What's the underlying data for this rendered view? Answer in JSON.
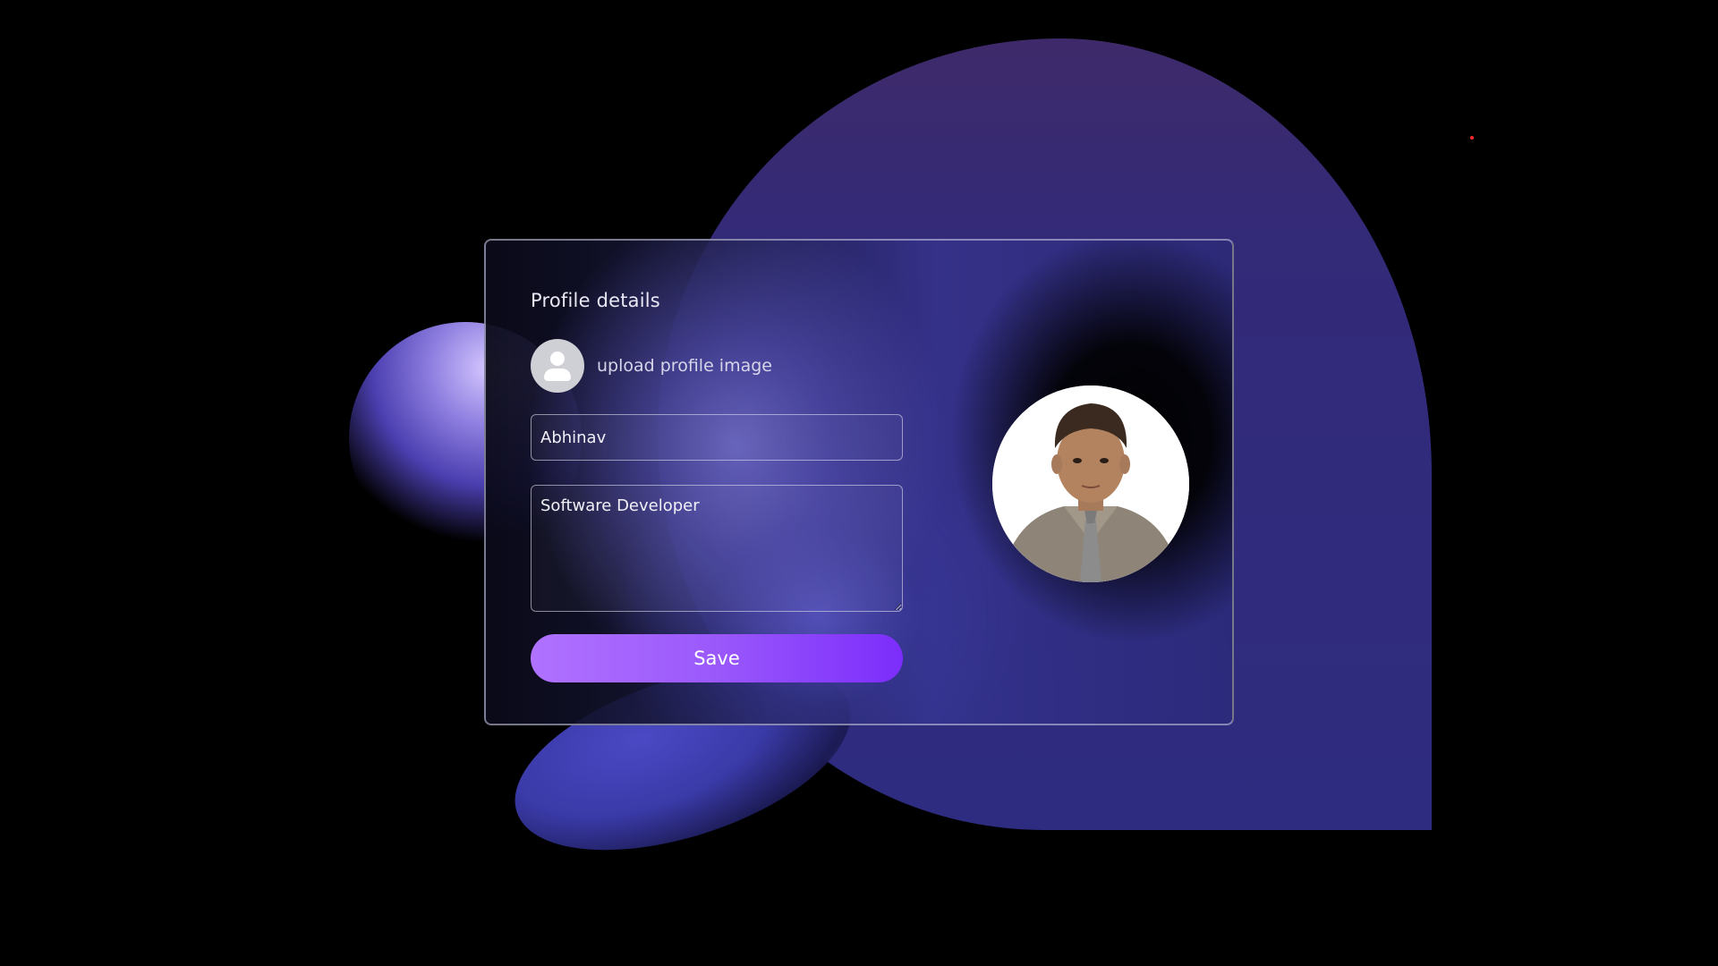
{
  "card": {
    "title": "Profile details",
    "upload_label": "upload profile image",
    "name_value": "Abhinav",
    "bio_value": "Software Developer",
    "save_label": "Save"
  },
  "icons": {
    "avatar_placeholder": "user-avatar-icon"
  },
  "colors": {
    "background": "#000000",
    "blob_primary": "#2e2c80",
    "save_gradient_start": "#b072ff",
    "save_gradient_end": "#7c2dfb",
    "text_primary": "#e9e7f4"
  }
}
